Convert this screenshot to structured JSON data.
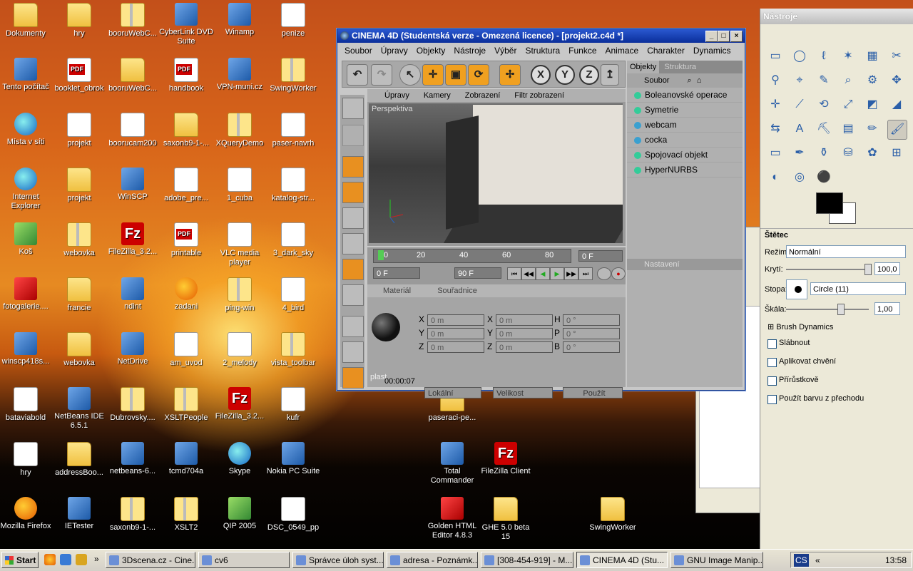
{
  "desktop_icons": [
    {
      "label": "Dokumenty",
      "kind": "folder"
    },
    {
      "label": "hry",
      "kind": "folder"
    },
    {
      "label": "booruWebC...",
      "kind": "zip"
    },
    {
      "label": "CyberLink DVD Suite",
      "kind": "app"
    },
    {
      "label": "Winamp",
      "kind": "app"
    },
    {
      "label": "penize",
      "kind": "doc"
    },
    {
      "label": "Tento počítač",
      "kind": "app"
    },
    {
      "label": "booklet_obrok",
      "kind": "pdf"
    },
    {
      "label": "booruWebC...",
      "kind": "folder"
    },
    {
      "label": "handbook",
      "kind": "pdf"
    },
    {
      "label": "VPN-muni.cz",
      "kind": "app"
    },
    {
      "label": "SwingWorker",
      "kind": "zip"
    },
    {
      "label": "Místa v síti",
      "kind": "globe"
    },
    {
      "label": "projekt",
      "kind": "doc"
    },
    {
      "label": "boorucam200",
      "kind": "doc"
    },
    {
      "label": "saxonb9-1-...",
      "kind": "folder"
    },
    {
      "label": "XQueryDemo",
      "kind": "zip"
    },
    {
      "label": "paser-navrh",
      "kind": "doc"
    },
    {
      "label": "Internet Explorer",
      "kind": "globe"
    },
    {
      "label": "projekt",
      "kind": "folder"
    },
    {
      "label": "WinSCP",
      "kind": "app"
    },
    {
      "label": "adobe_pre...",
      "kind": "doc"
    },
    {
      "label": "1_cuba",
      "kind": "doc"
    },
    {
      "label": "katalog-str...",
      "kind": "doc"
    },
    {
      "label": "Koš",
      "kind": "green"
    },
    {
      "label": "webovka",
      "kind": "zip"
    },
    {
      "label": "FileZilla_3.2...",
      "kind": "fz"
    },
    {
      "label": "printable",
      "kind": "pdf"
    },
    {
      "label": "VLC media player",
      "kind": "doc"
    },
    {
      "label": "3_dark_sky",
      "kind": "doc"
    },
    {
      "label": "fotogalerie....",
      "kind": "red"
    },
    {
      "label": "francie",
      "kind": "folder"
    },
    {
      "label": "ndint",
      "kind": "app"
    },
    {
      "label": "zadani",
      "kind": "ff"
    },
    {
      "label": "ping-win",
      "kind": "zip"
    },
    {
      "label": "4_bird",
      "kind": "doc"
    },
    {
      "label": "winscp418s...",
      "kind": "app"
    },
    {
      "label": "webovka",
      "kind": "folder"
    },
    {
      "label": "NetDrive",
      "kind": "app"
    },
    {
      "label": "am_uvod",
      "kind": "doc"
    },
    {
      "label": "2_melody",
      "kind": "doc"
    },
    {
      "label": "vista_toolbar",
      "kind": "zip"
    },
    {
      "label": "bataviabold",
      "kind": "doc"
    },
    {
      "label": "NetBeans IDE 6.5.1",
      "kind": "app"
    },
    {
      "label": "Dubrovsky....",
      "kind": "zip"
    },
    {
      "label": "XSLTPeople",
      "kind": "zip"
    },
    {
      "label": "FileZilla_3.2...",
      "kind": "fz"
    },
    {
      "label": "kufr",
      "kind": "doc"
    },
    {
      "label": "paseraci-pe...",
      "kind": "folder"
    },
    {
      "label": "hry",
      "kind": "doc"
    },
    {
      "label": "addressBoo...",
      "kind": "folder"
    },
    {
      "label": "netbeans-6...",
      "kind": "app"
    },
    {
      "label": "tcmd704a",
      "kind": "app"
    },
    {
      "label": "Skype",
      "kind": "globe"
    },
    {
      "label": "Nokia PC Suite",
      "kind": "app"
    },
    {
      "label": "Total Commander",
      "kind": "app"
    },
    {
      "label": "FileZilla Client",
      "kind": "fz"
    },
    {
      "label": "Mozilla Firefox",
      "kind": "ff"
    },
    {
      "label": "IETester",
      "kind": "app"
    },
    {
      "label": "saxonb9-1-...",
      "kind": "zip"
    },
    {
      "label": "XSLT2",
      "kind": "zip"
    },
    {
      "label": "QIP 2005",
      "kind": "green"
    },
    {
      "label": "DSC_0549_pp",
      "kind": "doc"
    },
    {
      "label": "Golden HTML Editor 4.8.3",
      "kind": "red"
    },
    {
      "label": "GHE 5.0 beta 15",
      "kind": "folder"
    },
    {
      "label": "SwingWorker",
      "kind": "folder"
    }
  ],
  "c4d": {
    "title": "CINEMA 4D (Studentská verze - Omezená licence) - [projekt2.c4d *]",
    "menu": [
      "Soubor",
      "Úpravy",
      "Objekty",
      "Nástroje",
      "Výběr",
      "Struktura",
      "Funkce",
      "Animace",
      "Charakter",
      "Dynamics"
    ],
    "viewport_menu": [
      "Úpravy",
      "Kamery",
      "Zobrazení",
      "Filtr zobrazení"
    ],
    "viewport_label": "Perspektiva",
    "ruler_ticks": [
      "0",
      "20",
      "40",
      "60",
      "80"
    ],
    "frame_field": "0 F",
    "start_field": "0 F",
    "end_field": "90 F",
    "attr_tabs": [
      "Materiál",
      "Souřadnice"
    ],
    "material_name": "plast",
    "coord_labels": [
      "X",
      "Y",
      "Z",
      "X",
      "Y",
      "Z",
      "H",
      "P",
      "B"
    ],
    "coord_value_position": "0 m",
    "coord_value_size": "0 m",
    "coord_value_angle": "0 °",
    "coord_mode": "Lokální",
    "coord_size_mode": "Velikost",
    "apply_button": "Použít",
    "timecode": "00:00:07",
    "obj_tabs": [
      "Objekty",
      "Struktura"
    ],
    "obj_menu": "Soubor",
    "objects": [
      "Boleanovské operace",
      "Symetrie",
      "webcam",
      "cocka",
      "Spojovací objekt",
      "HyperNURBS"
    ],
    "settings_tab": "Nastavení",
    "toolbar_axes": [
      "X",
      "Y",
      "Z"
    ]
  },
  "gimp": {
    "title": "Nástroje",
    "tool_options_title": "Štětec",
    "mode_label": "Režim:",
    "mode_value": "Normální",
    "opacity_label": "Krytí:",
    "opacity_value": "100,0",
    "brush_label": "Stopa:",
    "brush_value": "Circle (11)",
    "scale_label": "Škála:",
    "scale_value": "1,00",
    "brush_dynamics": "Brush Dynamics",
    "checkboxes": [
      "Slábnout",
      "Aplikovat chvění",
      "Přírůstkově",
      "Použít barvu z přechodu"
    ]
  },
  "taskbar": {
    "start": "Start",
    "tasks": [
      "3Dscena.cz - Cine...",
      "cv6",
      "Správce úloh syst...",
      "adresa - Poznámk...",
      "[308-454-919] - M...",
      "CINEMA 4D (Stu...",
      "GNU Image Manip..."
    ],
    "lang": "CS",
    "clock": "13:58"
  }
}
